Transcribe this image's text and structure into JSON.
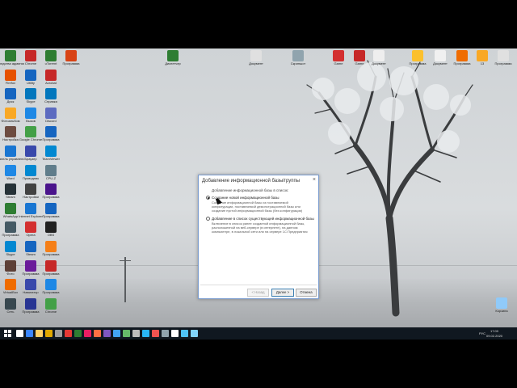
{
  "desktop": {
    "icons_left": [
      {
        "label": "Средства администрирования",
        "color": "#2e7d32"
      },
      {
        "label": "Firefox",
        "color": "#e65100"
      },
      {
        "label": "Диск",
        "color": "#1565c0"
      },
      {
        "label": "Фотоальбом",
        "color": "#f9a825"
      },
      {
        "label": "Настройка",
        "color": "#6d4c41"
      },
      {
        "label": "Панель управления",
        "color": "#1976d2"
      },
      {
        "label": "Word",
        "color": "#1e88e5"
      },
      {
        "label": "Steam",
        "color": "#263238"
      },
      {
        "label": "WhatsApp",
        "color": "#2e7d32"
      },
      {
        "label": "Программа",
        "color": "#455a64"
      },
      {
        "label": "Skype",
        "color": "#0288d1"
      },
      {
        "label": "Фото",
        "color": "#5d4037"
      },
      {
        "label": "VirtualBox",
        "color": "#ef6c00"
      },
      {
        "label": "Сеть",
        "color": "#37474f"
      },
      {
        "label": "Chrome",
        "color": "#c62828"
      },
      {
        "label": "Utility",
        "color": "#1565c0"
      },
      {
        "label": "Skype",
        "color": "#0277bd"
      },
      {
        "label": "Вызов",
        "color": "#1e88e5"
      },
      {
        "label": "Google Chrome",
        "color": "#43a047"
      },
      {
        "label": "Браузер",
        "color": "#3949ab"
      },
      {
        "label": "Проводник",
        "color": "#0288d1"
      },
      {
        "label": "Настройки",
        "color": "#424242"
      },
      {
        "label": "Internet Explorer",
        "color": "#1976d2"
      },
      {
        "label": "Opera",
        "color": "#d32f2f"
      },
      {
        "label": "Steam",
        "color": "#1565c0"
      },
      {
        "label": "Программа",
        "color": "#6a1b9a"
      },
      {
        "label": "Навигатор",
        "color": "#3949ab"
      },
      {
        "label": "Программа",
        "color": "#283593"
      },
      {
        "label": "uTorrent",
        "color": "#2e7d32"
      },
      {
        "label": "Acrobat",
        "color": "#c62828"
      },
      {
        "label": "Справка",
        "color": "#0277bd"
      },
      {
        "label": "Discord",
        "color": "#5c6bc0"
      },
      {
        "label": "Программа",
        "color": "#1565c0"
      },
      {
        "label": "TeamViewer",
        "color": "#0288d1"
      },
      {
        "label": "CPU-Z",
        "color": "#607d8b"
      },
      {
        "label": "Программа",
        "color": "#4a148c"
      },
      {
        "label": "Программа",
        "color": "#1565c0"
      },
      {
        "label": "OBS",
        "color": "#212121"
      },
      {
        "label": "Программа",
        "color": "#f57f17"
      },
      {
        "label": "Программа",
        "color": "#c62828"
      },
      {
        "label": "Программа",
        "color": "#1e88e5"
      },
      {
        "label": "Chrome",
        "color": "#43a047"
      },
      {
        "label": "Программа",
        "color": "#d84315"
      }
    ],
    "icons_top": [
      {
        "label": "Диспетчер",
        "color": "#2e7d32"
      },
      {
        "label": "Документ",
        "color": "#e0e0e0"
      },
      {
        "label": "Скриншот",
        "color": "#90a4ae"
      },
      {
        "label": "Game",
        "color": "#d32f2f"
      },
      {
        "label": "Game",
        "color": "#c62828"
      },
      {
        "label": "Документ",
        "color": "#eeeeee"
      },
      {
        "label": "Программа",
        "color": "#fbc02d"
      },
      {
        "label": "Документ",
        "color": "#f0f0f0"
      },
      {
        "label": "Программа",
        "color": "#ef6c00"
      },
      {
        "label": "13",
        "color": "#f9a825"
      },
      {
        "label": "Программа",
        "color": "#e0e0e0"
      }
    ],
    "recycle_bin": {
      "label": "Корзина",
      "color": "#90caf9"
    }
  },
  "dialog": {
    "title": "Добавление информационной базы/группы",
    "close": "×",
    "section_label": "Добавление информационной базы в список:",
    "option1": {
      "title": "Создание новой информационной базы",
      "desc": "Создание информационной базы из поставляемой конфигурации, поставляемой демонстрационной базы или создание пустой информационной базы (без конфигурации)"
    },
    "option2": {
      "title": "Добавление в список существующей информационной базы",
      "desc": "Включение в список ранее созданной информационной базы, расположенной на веб-сервере (в интернете), на данном компьютере, в локальной сети или на сервере 1С:Предприятия"
    },
    "buttons": {
      "back": "< Назад",
      "next": "Далее >",
      "cancel": "Отмена"
    }
  },
  "taskbar": {
    "apps": [
      "#ffffff",
      "#3a86ff",
      "#ffd166",
      "#e0a800",
      "#9e9e9e",
      "#e53935",
      "#2e7d32",
      "#e91e63",
      "#ff7043",
      "#7e57c2",
      "#42a5f5",
      "#66bb6a",
      "#bdbdbd",
      "#29b6f6",
      "#ef5350",
      "#90a4ae",
      "#ffffff",
      "#4fc3f7",
      "#81d4fa"
    ],
    "tray": {
      "lang": "РУС",
      "time": "17:00",
      "date": "09.02.2020"
    }
  }
}
